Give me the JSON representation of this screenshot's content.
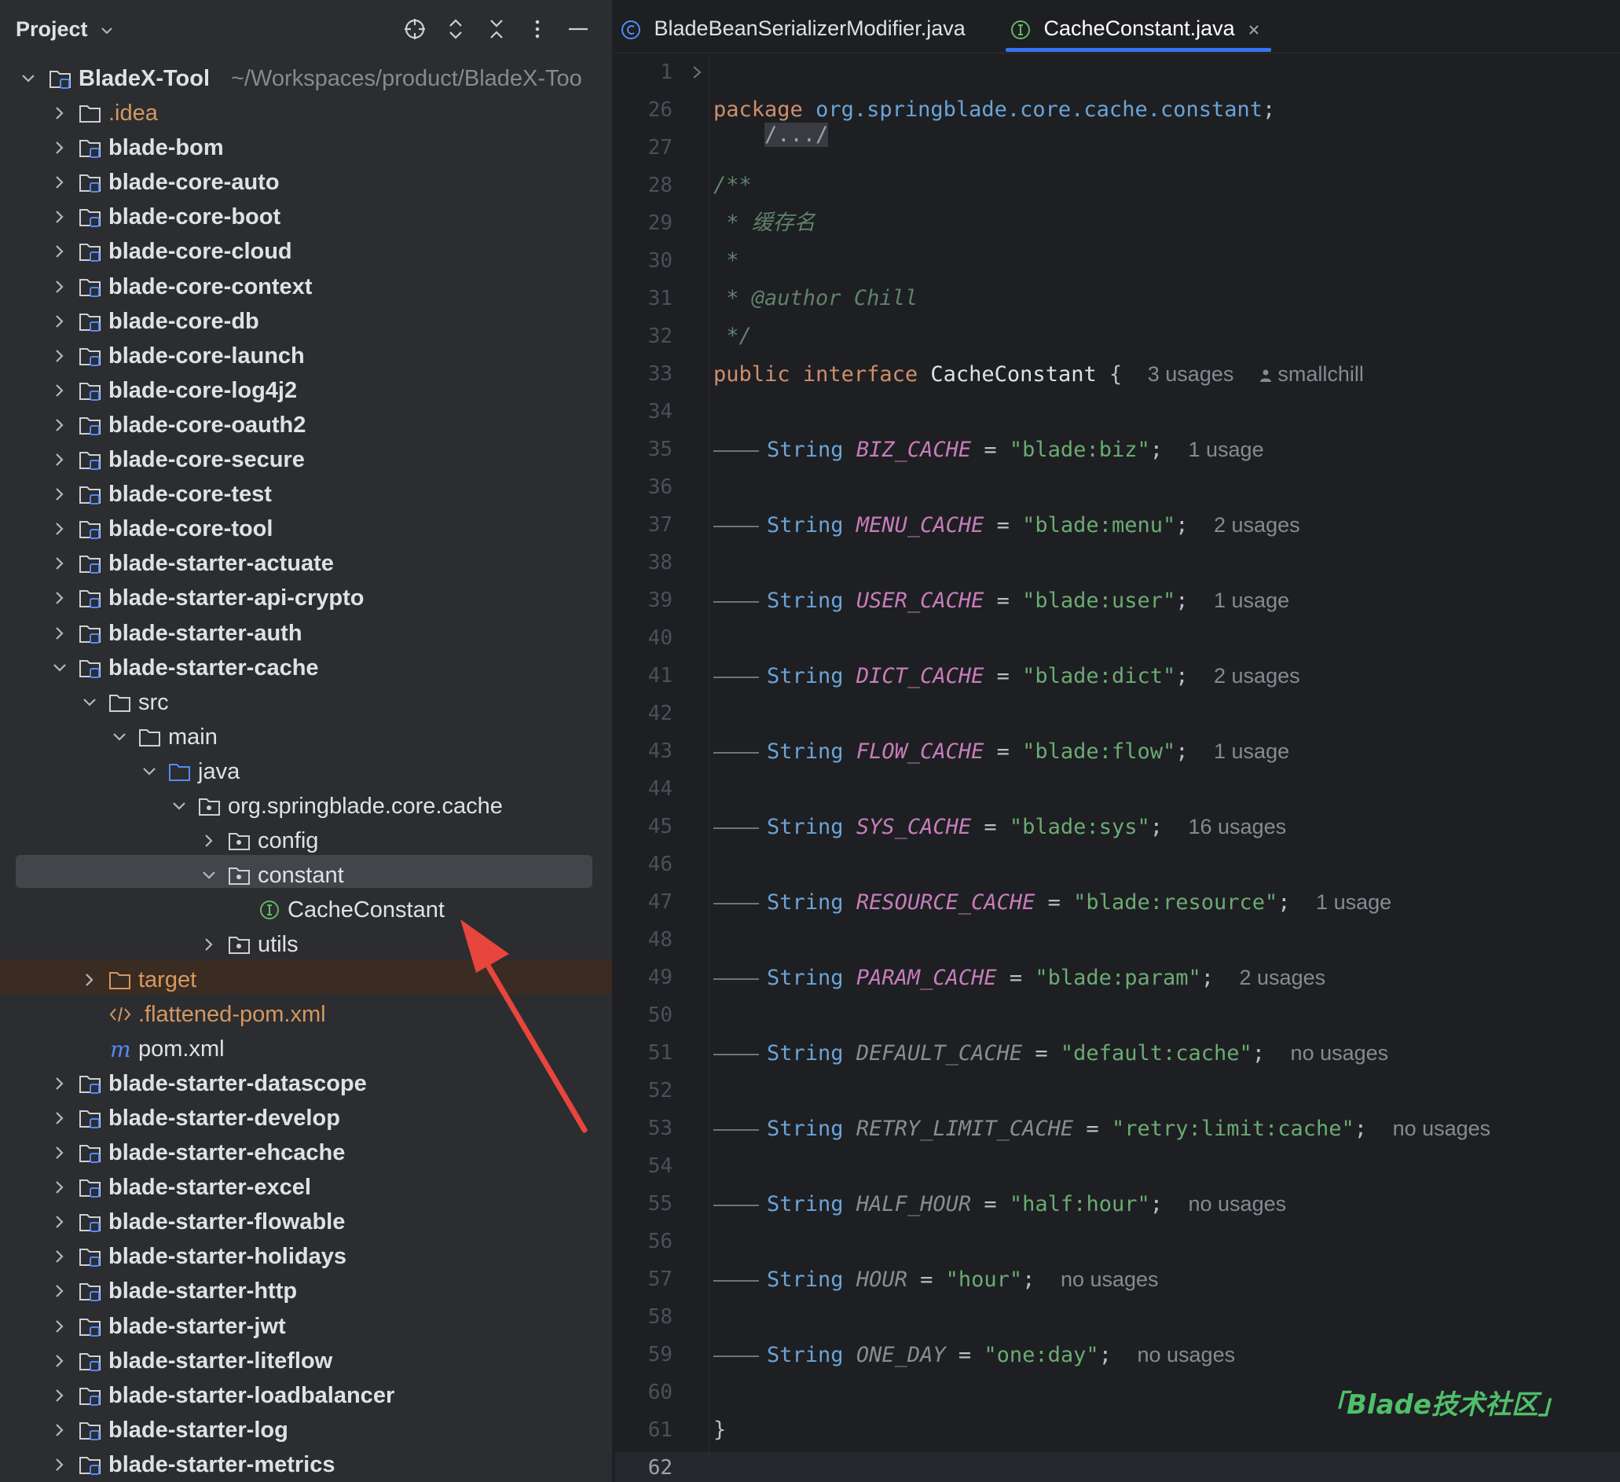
{
  "project_panel": {
    "title": "Project",
    "toolbar_icons": [
      "locate-icon",
      "expand-all-icon",
      "collapse-all-icon",
      "more-options-icon",
      "hide-panel-icon"
    ],
    "root": {
      "label": "BladeX-Tool",
      "path": "~/Workspaces/product/BladeX-Too"
    },
    "tree": [
      {
        "label": ".idea",
        "depth": 1,
        "expanded": false,
        "icon": "folder",
        "style": "orange"
      },
      {
        "label": "blade-bom",
        "depth": 1,
        "expanded": false,
        "icon": "module",
        "style": "bold"
      },
      {
        "label": "blade-core-auto",
        "depth": 1,
        "expanded": false,
        "icon": "module",
        "style": "bold"
      },
      {
        "label": "blade-core-boot",
        "depth": 1,
        "expanded": false,
        "icon": "module",
        "style": "bold"
      },
      {
        "label": "blade-core-cloud",
        "depth": 1,
        "expanded": false,
        "icon": "module",
        "style": "bold"
      },
      {
        "label": "blade-core-context",
        "depth": 1,
        "expanded": false,
        "icon": "module",
        "style": "bold"
      },
      {
        "label": "blade-core-db",
        "depth": 1,
        "expanded": false,
        "icon": "module",
        "style": "bold"
      },
      {
        "label": "blade-core-launch",
        "depth": 1,
        "expanded": false,
        "icon": "module",
        "style": "bold"
      },
      {
        "label": "blade-core-log4j2",
        "depth": 1,
        "expanded": false,
        "icon": "module",
        "style": "bold"
      },
      {
        "label": "blade-core-oauth2",
        "depth": 1,
        "expanded": false,
        "icon": "module",
        "style": "bold"
      },
      {
        "label": "blade-core-secure",
        "depth": 1,
        "expanded": false,
        "icon": "module",
        "style": "bold"
      },
      {
        "label": "blade-core-test",
        "depth": 1,
        "expanded": false,
        "icon": "module",
        "style": "bold"
      },
      {
        "label": "blade-core-tool",
        "depth": 1,
        "expanded": false,
        "icon": "module",
        "style": "bold"
      },
      {
        "label": "blade-starter-actuate",
        "depth": 1,
        "expanded": false,
        "icon": "module",
        "style": "bold"
      },
      {
        "label": "blade-starter-api-crypto",
        "depth": 1,
        "expanded": false,
        "icon": "module",
        "style": "bold"
      },
      {
        "label": "blade-starter-auth",
        "depth": 1,
        "expanded": false,
        "icon": "module",
        "style": "bold"
      },
      {
        "label": "blade-starter-cache",
        "depth": 1,
        "expanded": true,
        "icon": "module",
        "style": "bold"
      },
      {
        "label": "src",
        "depth": 2,
        "expanded": true,
        "icon": "folder",
        "style": "normal"
      },
      {
        "label": "main",
        "depth": 3,
        "expanded": true,
        "icon": "folder",
        "style": "normal"
      },
      {
        "label": "java",
        "depth": 4,
        "expanded": true,
        "icon": "source-folder",
        "style": "normal"
      },
      {
        "label": "org.springblade.core.cache",
        "depth": 5,
        "expanded": true,
        "icon": "package",
        "style": "normal"
      },
      {
        "label": "config",
        "depth": 6,
        "expanded": false,
        "icon": "package",
        "style": "normal"
      },
      {
        "label": "constant",
        "depth": 6,
        "expanded": true,
        "icon": "package",
        "style": "normal",
        "selected": true
      },
      {
        "label": "CacheConstant",
        "depth": 7,
        "expanded": null,
        "icon": "interface",
        "style": "normal"
      },
      {
        "label": "utils",
        "depth": 6,
        "expanded": false,
        "icon": "package",
        "style": "normal"
      },
      {
        "label": "target",
        "depth": 2,
        "expanded": false,
        "icon": "excluded-folder",
        "style": "orange"
      },
      {
        "label": ".flattened-pom.xml",
        "depth": 2,
        "expanded": null,
        "icon": "xml",
        "style": "orange"
      },
      {
        "label": "pom.xml",
        "depth": 2,
        "expanded": null,
        "icon": "maven",
        "style": "normal"
      },
      {
        "label": "blade-starter-datascope",
        "depth": 1,
        "expanded": false,
        "icon": "module",
        "style": "bold"
      },
      {
        "label": "blade-starter-develop",
        "depth": 1,
        "expanded": false,
        "icon": "module",
        "style": "bold"
      },
      {
        "label": "blade-starter-ehcache",
        "depth": 1,
        "expanded": false,
        "icon": "module",
        "style": "bold"
      },
      {
        "label": "blade-starter-excel",
        "depth": 1,
        "expanded": false,
        "icon": "module",
        "style": "bold"
      },
      {
        "label": "blade-starter-flowable",
        "depth": 1,
        "expanded": false,
        "icon": "module",
        "style": "bold"
      },
      {
        "label": "blade-starter-holidays",
        "depth": 1,
        "expanded": false,
        "icon": "module",
        "style": "bold"
      },
      {
        "label": "blade-starter-http",
        "depth": 1,
        "expanded": false,
        "icon": "module",
        "style": "bold"
      },
      {
        "label": "blade-starter-jwt",
        "depth": 1,
        "expanded": false,
        "icon": "module",
        "style": "bold"
      },
      {
        "label": "blade-starter-liteflow",
        "depth": 1,
        "expanded": false,
        "icon": "module",
        "style": "bold"
      },
      {
        "label": "blade-starter-loadbalancer",
        "depth": 1,
        "expanded": false,
        "icon": "module",
        "style": "bold"
      },
      {
        "label": "blade-starter-log",
        "depth": 1,
        "expanded": false,
        "icon": "module",
        "style": "bold"
      },
      {
        "label": "blade-starter-metrics",
        "depth": 1,
        "expanded": false,
        "icon": "module",
        "style": "bold"
      }
    ]
  },
  "tabs": [
    {
      "label": "BladeBeanSerializerModifier.java",
      "icon": "class-icon",
      "active": false
    },
    {
      "label": "CacheConstant.java",
      "icon": "interface-icon",
      "active": true,
      "closable": true
    }
  ],
  "editor": {
    "folded": "/.../",
    "package_kw": "package",
    "package_name": "org.springblade.core.cache.constant",
    "doc_open": "/**",
    "doc_desc": "* 缓存名",
    "doc_blank": "*",
    "doc_author_tag": "* @author",
    "doc_author": "Chill",
    "doc_close": "*/",
    "class_public": "public",
    "class_interface": "interface",
    "class_name": "CacheConstant",
    "class_brace": "{",
    "class_usages": "3 usages",
    "class_author": "smallchill",
    "close_brace": "}",
    "line_numbers": [
      "1",
      "26",
      "27",
      "28",
      "29",
      "30",
      "31",
      "32",
      "33",
      "34",
      "35",
      "36",
      "37",
      "38",
      "39",
      "40",
      "41",
      "42",
      "43",
      "44",
      "45",
      "46",
      "47",
      "48",
      "49",
      "50",
      "51",
      "52",
      "53",
      "54",
      "55",
      "56",
      "57",
      "58",
      "59",
      "60",
      "61",
      "62"
    ],
    "fields": [
      {
        "type": "String",
        "name": "BIZ_CACHE",
        "value": "\"blade:biz\"",
        "usages": "1 usage",
        "used": true
      },
      {
        "type": "String",
        "name": "MENU_CACHE",
        "value": "\"blade:menu\"",
        "usages": "2 usages",
        "used": true
      },
      {
        "type": "String",
        "name": "USER_CACHE",
        "value": "\"blade:user\"",
        "usages": "1 usage",
        "used": true
      },
      {
        "type": "String",
        "name": "DICT_CACHE",
        "value": "\"blade:dict\"",
        "usages": "2 usages",
        "used": true
      },
      {
        "type": "String",
        "name": "FLOW_CACHE",
        "value": "\"blade:flow\"",
        "usages": "1 usage",
        "used": true
      },
      {
        "type": "String",
        "name": "SYS_CACHE",
        "value": "\"blade:sys\"",
        "usages": "16 usages",
        "used": true
      },
      {
        "type": "String",
        "name": "RESOURCE_CACHE",
        "value": "\"blade:resource\"",
        "usages": "1 usage",
        "used": true
      },
      {
        "type": "String",
        "name": "PARAM_CACHE",
        "value": "\"blade:param\"",
        "usages": "2 usages",
        "used": true
      },
      {
        "type": "String",
        "name": "DEFAULT_CACHE",
        "value": "\"default:cache\"",
        "usages": "no usages",
        "used": false
      },
      {
        "type": "String",
        "name": "RETRY_LIMIT_CACHE",
        "value": "\"retry:limit:cache\"",
        "usages": "no usages",
        "used": false
      },
      {
        "type": "String",
        "name": "HALF_HOUR",
        "value": "\"half:hour\"",
        "usages": "no usages",
        "used": false
      },
      {
        "type": "String",
        "name": "HOUR",
        "value": "\"hour\"",
        "usages": "no usages",
        "used": false
      },
      {
        "type": "String",
        "name": "ONE_DAY",
        "value": "\"one:day\"",
        "usages": "no usages",
        "used": false
      }
    ]
  },
  "watermark": "「Blade技术社区」",
  "colors": {
    "annotation_arrow": "#e8453c",
    "accent_tab": "#3574f0",
    "selection": "#43454a"
  }
}
